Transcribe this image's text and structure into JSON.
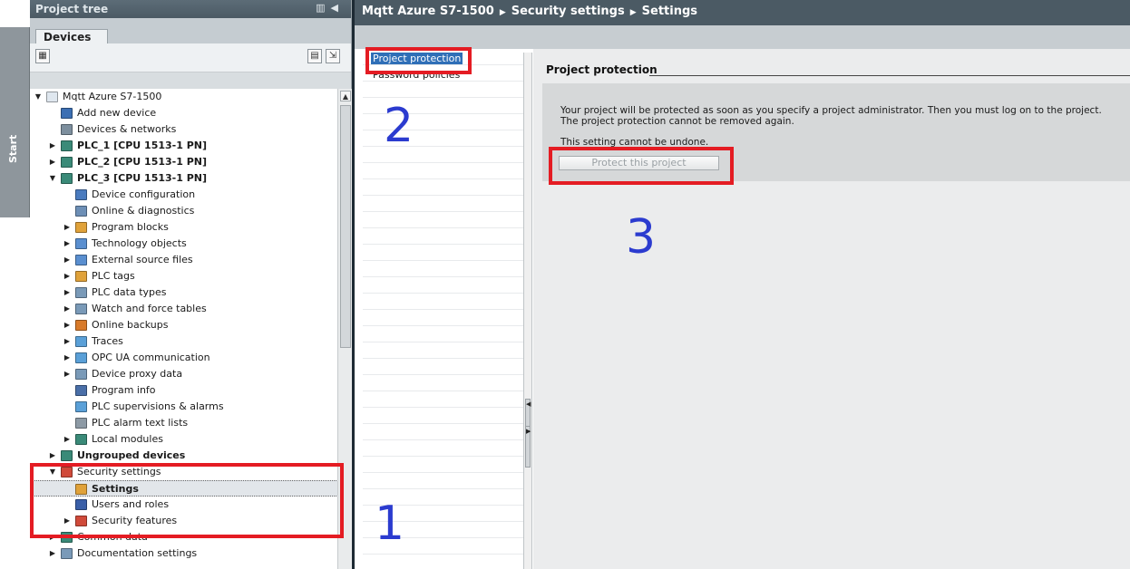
{
  "start_tab": {
    "label": "Start"
  },
  "tree_panel": {
    "title": "Project tree",
    "tab": "Devices",
    "items": [
      {
        "label": "Mqtt Azure S7-1500",
        "indent": 0,
        "arrow": "down",
        "bold": false,
        "icon_color": "#dfe7ef"
      },
      {
        "label": "Add new device",
        "indent": 1,
        "arrow": "",
        "bold": false,
        "icon_color": "#3c6fb3"
      },
      {
        "label": "Devices & networks",
        "indent": 1,
        "arrow": "",
        "bold": false,
        "icon_color": "#7d8f9e"
      },
      {
        "label": "PLC_1 [CPU 1513-1 PN]",
        "indent": 1,
        "arrow": "right",
        "bold": true,
        "icon_color": "#3a8a78"
      },
      {
        "label": "PLC_2 [CPU 1513-1 PN]",
        "indent": 1,
        "arrow": "right",
        "bold": true,
        "icon_color": "#3a8a78"
      },
      {
        "label": "PLC_3 [CPU 1513-1 PN]",
        "indent": 1,
        "arrow": "down",
        "bold": true,
        "icon_color": "#3a8a78"
      },
      {
        "label": "Device configuration",
        "indent": 2,
        "arrow": "",
        "bold": false,
        "icon_color": "#4a7bbf"
      },
      {
        "label": "Online & diagnostics",
        "indent": 2,
        "arrow": "",
        "bold": false,
        "icon_color": "#6d8fb6"
      },
      {
        "label": "Program blocks",
        "indent": 2,
        "arrow": "right",
        "bold": false,
        "icon_color": "#e0a23a"
      },
      {
        "label": "Technology objects",
        "indent": 2,
        "arrow": "right",
        "bold": false,
        "icon_color": "#5a8fd0"
      },
      {
        "label": "External source files",
        "indent": 2,
        "arrow": "right",
        "bold": false,
        "icon_color": "#5a8fd0"
      },
      {
        "label": "PLC tags",
        "indent": 2,
        "arrow": "right",
        "bold": false,
        "icon_color": "#e0a23a"
      },
      {
        "label": "PLC data types",
        "indent": 2,
        "arrow": "right",
        "bold": false,
        "icon_color": "#7a9ab8"
      },
      {
        "label": "Watch and force tables",
        "indent": 2,
        "arrow": "right",
        "bold": false,
        "icon_color": "#7a9ab8"
      },
      {
        "label": "Online backups",
        "indent": 2,
        "arrow": "right",
        "bold": false,
        "icon_color": "#d87a2a"
      },
      {
        "label": "Traces",
        "indent": 2,
        "arrow": "right",
        "bold": false,
        "icon_color": "#5aa0d8"
      },
      {
        "label": "OPC UA communication",
        "indent": 2,
        "arrow": "right",
        "bold": false,
        "icon_color": "#5aa0d8"
      },
      {
        "label": "Device proxy data",
        "indent": 2,
        "arrow": "right",
        "bold": false,
        "icon_color": "#7a9ab8"
      },
      {
        "label": "Program info",
        "indent": 2,
        "arrow": "",
        "bold": false,
        "icon_color": "#4a6fa8"
      },
      {
        "label": "PLC supervisions & alarms",
        "indent": 2,
        "arrow": "",
        "bold": false,
        "icon_color": "#5aa0d8"
      },
      {
        "label": "PLC alarm text lists",
        "indent": 2,
        "arrow": "",
        "bold": false,
        "icon_color": "#8d9aa5"
      },
      {
        "label": "Local modules",
        "indent": 2,
        "arrow": "right",
        "bold": false,
        "icon_color": "#3a8a78"
      },
      {
        "label": "Ungrouped devices",
        "indent": 1,
        "arrow": "right",
        "bold": true,
        "icon_color": "#3a8a78"
      },
      {
        "label": "Security settings",
        "indent": 1,
        "arrow": "down",
        "bold": false,
        "icon_color": "#d04a3a"
      },
      {
        "label": "Settings",
        "indent": 2,
        "arrow": "",
        "bold": true,
        "icon_color": "#e0a23a",
        "selected": true
      },
      {
        "label": "Users and roles",
        "indent": 2,
        "arrow": "",
        "bold": false,
        "icon_color": "#3a5fa8"
      },
      {
        "label": "Security features",
        "indent": 2,
        "arrow": "right",
        "bold": false,
        "icon_color": "#d04a3a"
      },
      {
        "label": "Common data",
        "indent": 1,
        "arrow": "right",
        "bold": false,
        "icon_color": "#3a8a78"
      },
      {
        "label": "Documentation settings",
        "indent": 1,
        "arrow": "right",
        "bold": false,
        "icon_color": "#7a9ab8"
      }
    ]
  },
  "breadcrumb": [
    "Mqtt Azure S7-1500",
    "Security settings",
    "Settings"
  ],
  "nav": {
    "items": [
      {
        "label": "Project protection",
        "active": true
      },
      {
        "label": "Password policies",
        "active": false
      }
    ]
  },
  "content": {
    "section_title": "Project protection",
    "info_text": "Your project will be protected as soon as you specify a project administrator. Then you must log on to the project. The project protection cannot be removed again.",
    "note": "This setting cannot be undone.",
    "button_label": "Protect this project"
  },
  "annotations": {
    "num1": "1",
    "num2": "2",
    "num3": "3",
    "box_color": "#e41c23",
    "num_color": "#2b3bcf"
  }
}
